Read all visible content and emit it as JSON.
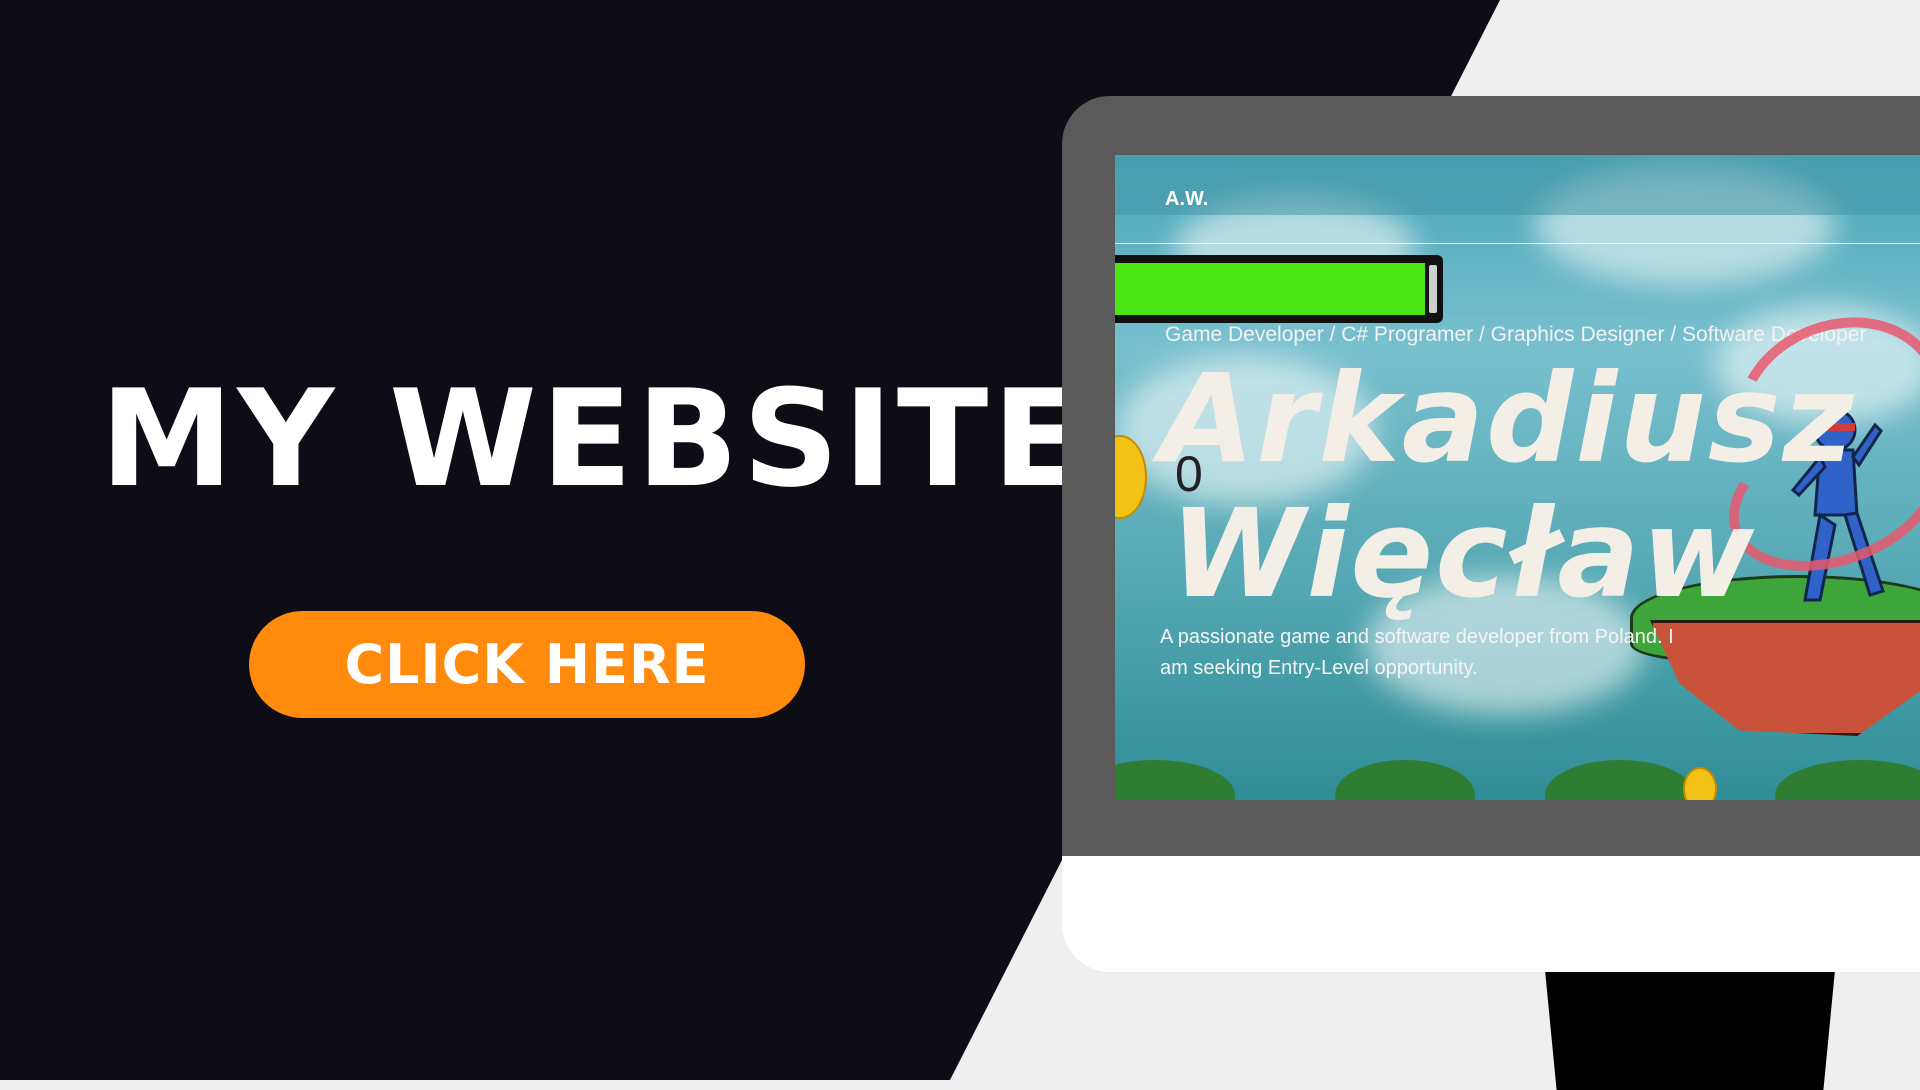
{
  "banner": {
    "headline": "MY WEBSITE",
    "cta_label": "CLICK HERE"
  },
  "colors": {
    "dark_background": "#0e0d15",
    "light_background": "#f0efef",
    "cta": "#ff8a0c",
    "health_bar": "#4be516"
  },
  "website": {
    "logo": "A.W.",
    "roles": "Game Developer / C# Programer / Graphics Designer / Software Developer",
    "name_first": "Arkadiusz",
    "name_last": "Więcław",
    "bio": "A passionate game and software developer from Poland. I am seeking Entry-Level opportunity.",
    "score": "0",
    "health_fraction": 0.97
  }
}
